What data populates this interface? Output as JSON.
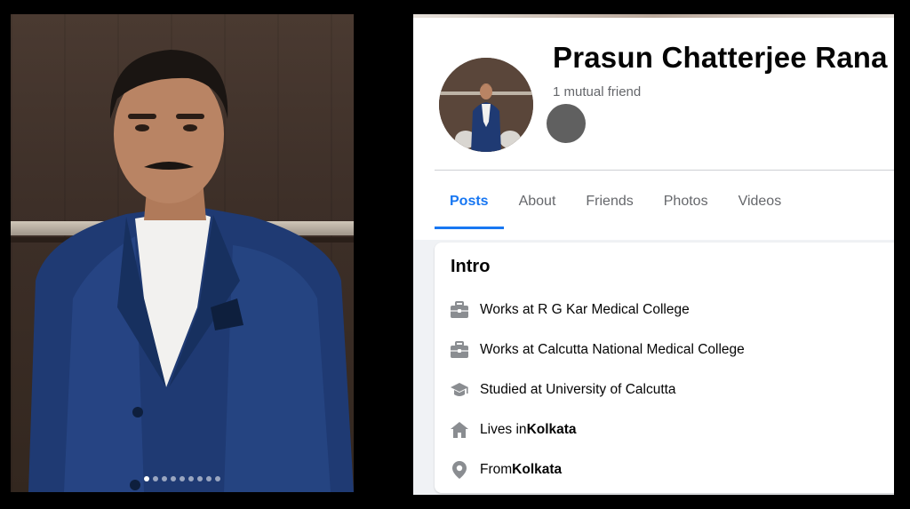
{
  "photo": {
    "dots_total": 9,
    "active_dot": 1
  },
  "profile": {
    "name": "Prasun Chatterjee Rana",
    "mutual_friends": "1 mutual friend"
  },
  "tabs": [
    {
      "label": "Posts",
      "active": true
    },
    {
      "label": "About",
      "active": false
    },
    {
      "label": "Friends",
      "active": false
    },
    {
      "label": "Photos",
      "active": false
    },
    {
      "label": "Videos",
      "active": false
    }
  ],
  "intro": {
    "title": "Intro",
    "items": [
      {
        "icon": "briefcase-icon",
        "prefix": "Works at R G Kar Medical College",
        "bold": ""
      },
      {
        "icon": "briefcase-icon",
        "prefix": "Works at Calcutta National Medical College",
        "bold": ""
      },
      {
        "icon": "graduation-cap-icon",
        "prefix": "Studied at University of Calcutta",
        "bold": ""
      },
      {
        "icon": "home-icon",
        "prefix": "Lives in ",
        "bold": "Kolkata"
      },
      {
        "icon": "location-pin-icon",
        "prefix": "From ",
        "bold": "Kolkata"
      }
    ]
  },
  "colors": {
    "accent": "#1877f2",
    "icon_gray": "#8a8d91",
    "secondary_text": "#65676b"
  }
}
